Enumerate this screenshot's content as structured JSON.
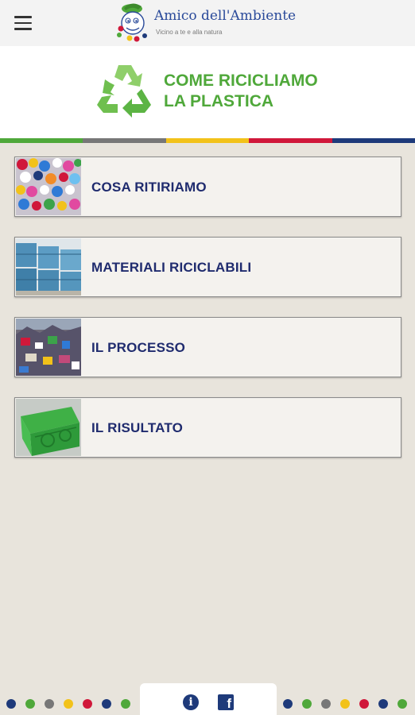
{
  "app_bar": {
    "brand_name": "Amico dell'Ambiente",
    "tagline": "Vicino a te e alla natura",
    "menu_icon": "hamburger-menu-icon",
    "logo_icon": "mascot-logo-icon"
  },
  "header": {
    "title_line1": "COME RICICLIAMO",
    "title_line2": "LA PLASTICA",
    "icon": "recycle-icon",
    "title_color": "#4fa83a"
  },
  "stripe_colors": [
    "#4fa83a",
    "#777777",
    "#f2c21a",
    "#d0183a",
    "#1e3a7a"
  ],
  "menu": {
    "items": [
      {
        "label": "COSA RITIRIAMO",
        "thumb": "plastic-caps-thumbnail"
      },
      {
        "label": "MATERIALI RICICLABILI",
        "thumb": "baled-bottles-thumbnail"
      },
      {
        "label": "IL PROCESSO",
        "thumb": "plastic-waste-thumbnail"
      },
      {
        "label": "IL RISULTATO",
        "thumb": "green-crate-thumbnail"
      }
    ]
  },
  "bottom_bar": {
    "info_icon": "info-icon",
    "facebook_icon": "facebook-icon",
    "dot_colors": [
      "#1e3a7a",
      "#4fa83a",
      "#777777",
      "#f2c21a",
      "#d0183a",
      "#1e3a7a",
      "#4fa83a"
    ]
  },
  "colors": {
    "background": "#e8e4dc",
    "menu_text": "#1f2b6e",
    "brand_text": "#2a4a9a"
  }
}
